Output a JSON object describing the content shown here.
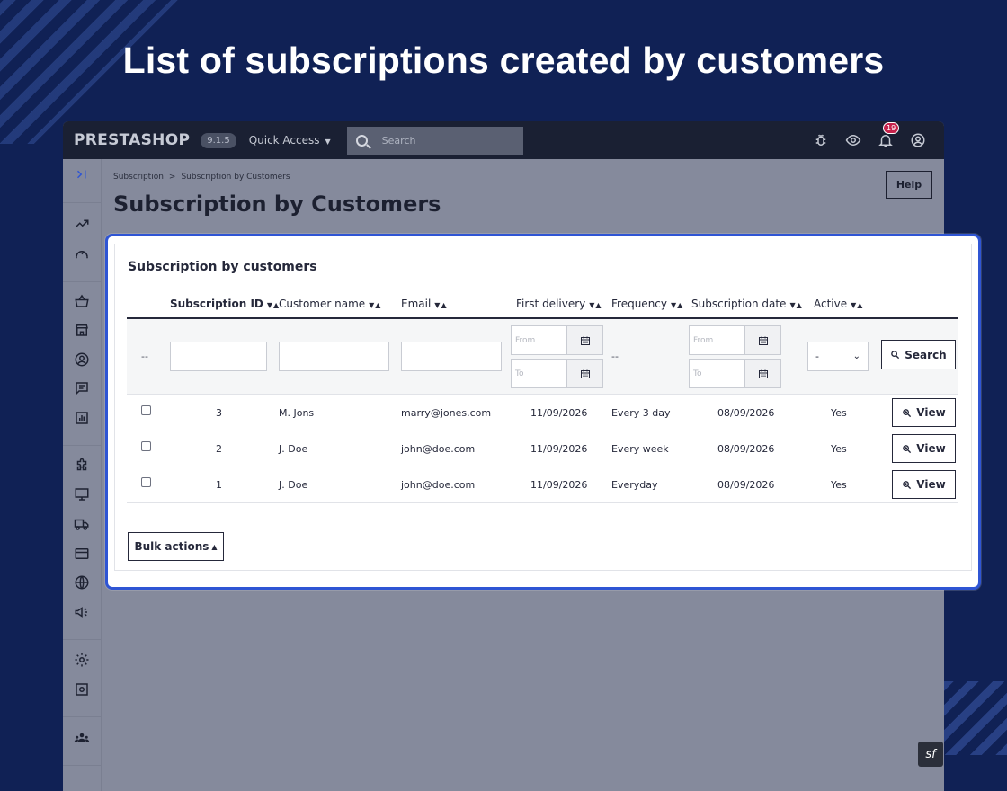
{
  "headline": "List of subscriptions created by customers",
  "topbar": {
    "brand": "PRESTASHOP",
    "version": "9.1.5",
    "quick_access": "Quick Access",
    "search_placeholder": "Search",
    "notifications_count": "19"
  },
  "breadcrumb": {
    "parent": "Subscription",
    "current": "Subscription by Customers"
  },
  "page_title": "Subscription by Customers",
  "help_label": "Help",
  "card": {
    "title": "Subscription by customers",
    "columns": [
      "Subscription ID",
      "Customer name",
      "Email",
      "First delivery",
      "Frequency",
      "Subscription date",
      "Active"
    ],
    "filters": {
      "dash": "--",
      "from_placeholder": "From",
      "to_placeholder": "To",
      "active_value": "-",
      "search_label": "Search"
    },
    "rows": [
      {
        "id": "3",
        "name": "M. Jons",
        "email": "marry@jones.com",
        "first_delivery": "11/09/2026",
        "frequency": "Every 3 day",
        "date": "08/09/2026",
        "active": "Yes"
      },
      {
        "id": "2",
        "name": "J. Doe",
        "email": "john@doe.com",
        "first_delivery": "11/09/2026",
        "frequency": "Every week",
        "date": "08/09/2026",
        "active": "Yes"
      },
      {
        "id": "1",
        "name": "J. Doe",
        "email": "john@doe.com",
        "first_delivery": "11/09/2026",
        "frequency": "Everyday",
        "date": "08/09/2026",
        "active": "Yes"
      }
    ],
    "view_label": "View",
    "bulk_label": "Bulk actions"
  },
  "colors": {
    "background": "#102155",
    "highlight": "#2f55d4",
    "topbar": "#1a2033"
  }
}
